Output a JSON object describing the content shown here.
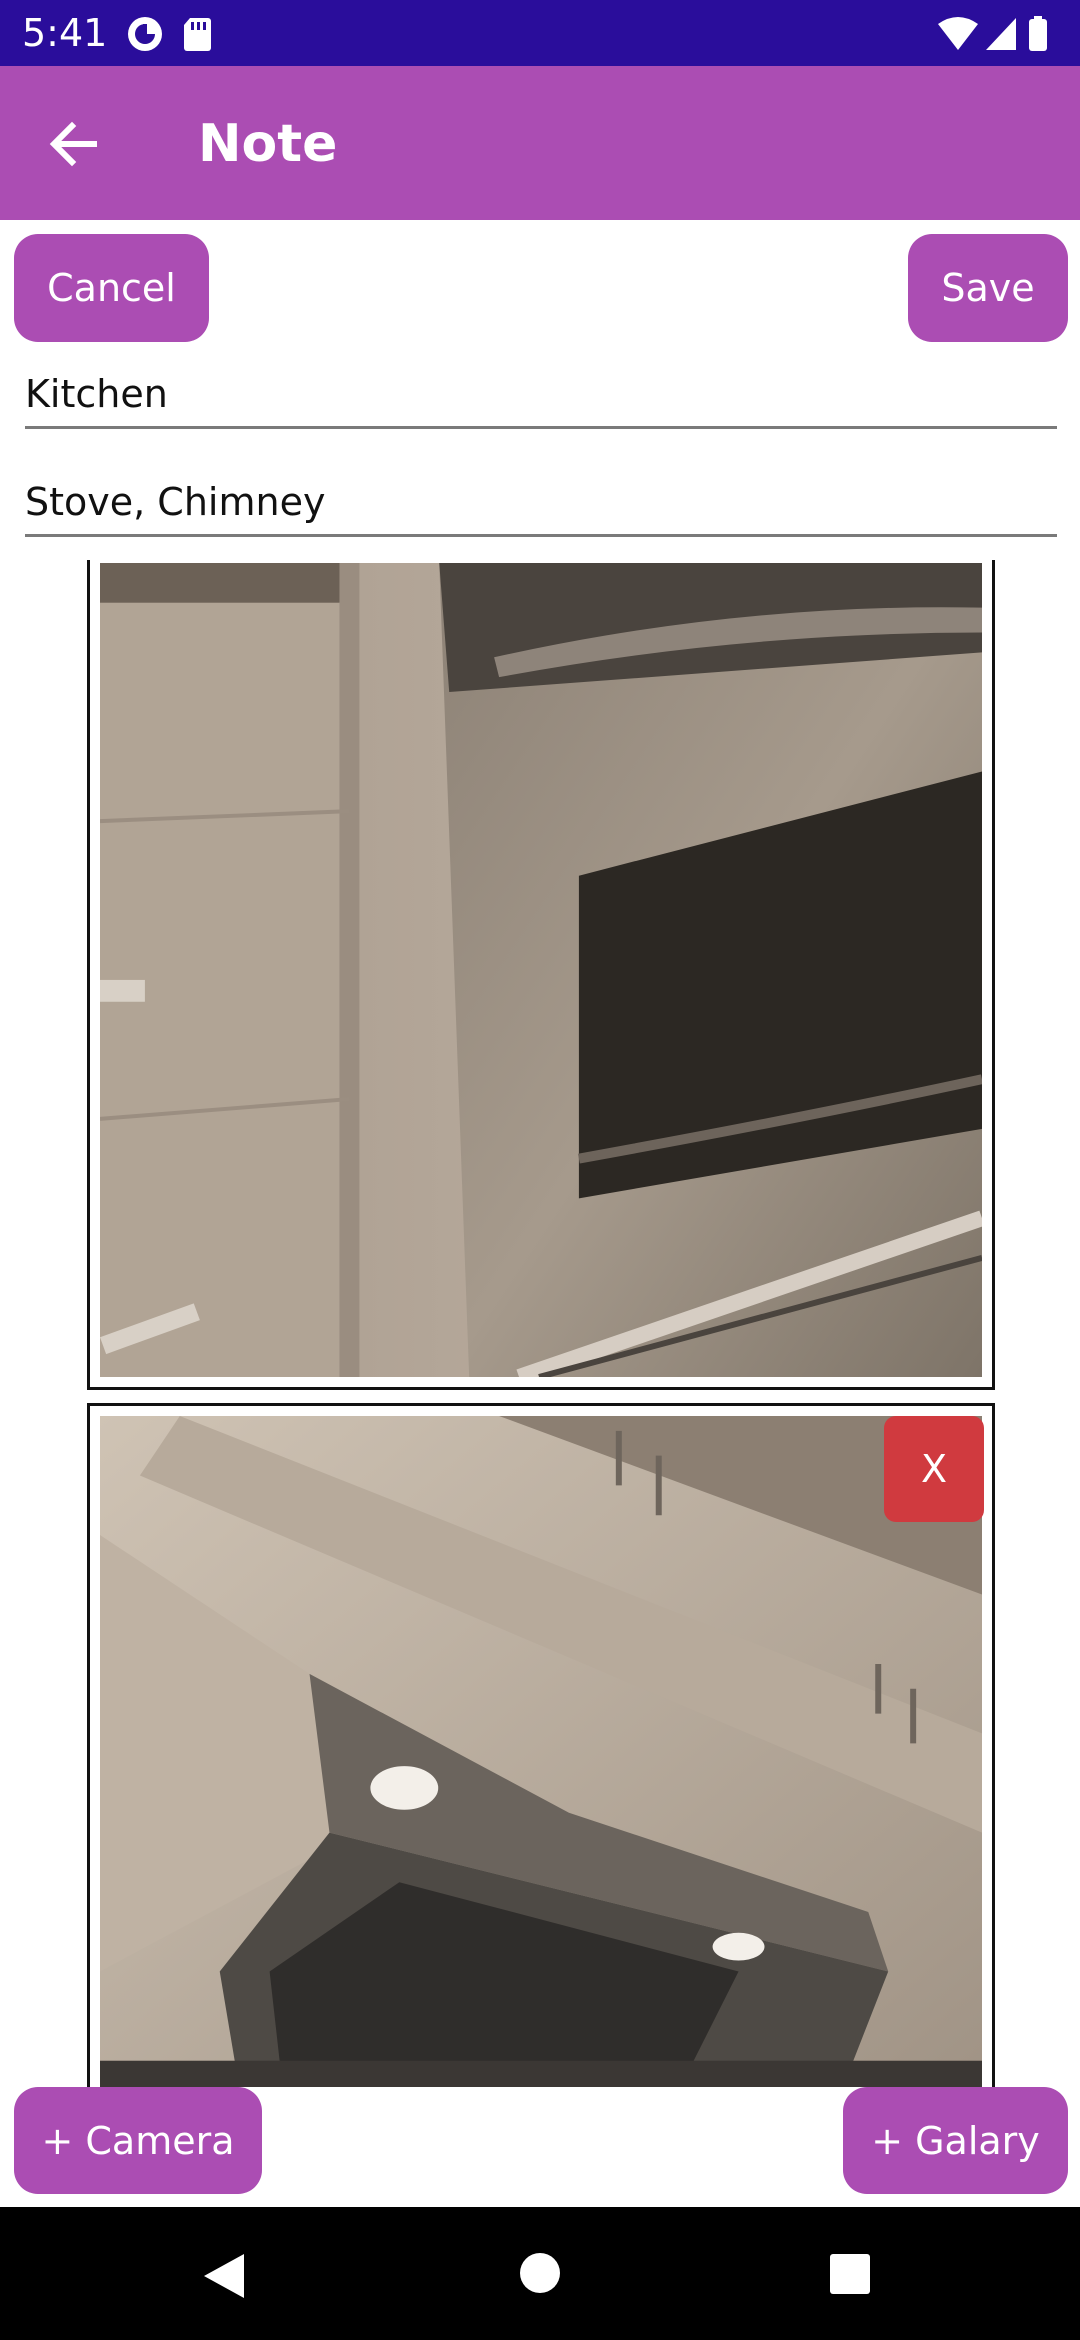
{
  "status_bar": {
    "time": "5:41",
    "left_icons": [
      "data-saver-icon",
      "sd-card-icon"
    ],
    "right_icons": [
      "wifi-icon",
      "signal-icon",
      "battery-icon"
    ]
  },
  "app_bar": {
    "title": "Note",
    "back_icon": "arrow-left-icon",
    "color": "#ab4db3"
  },
  "actions": {
    "cancel_label": "Cancel",
    "save_label": "Save"
  },
  "form": {
    "title_value": "Kitchen",
    "tags_value": "Stove, Chimney"
  },
  "photos": {
    "delete_label": "X"
  },
  "bottom_actions": {
    "camera_label": "+ Camera",
    "gallery_label": "+ Galary"
  },
  "colors": {
    "status_bar": "#2a0d9b",
    "accent": "#ab4db3",
    "delete": "#d03a3f"
  }
}
